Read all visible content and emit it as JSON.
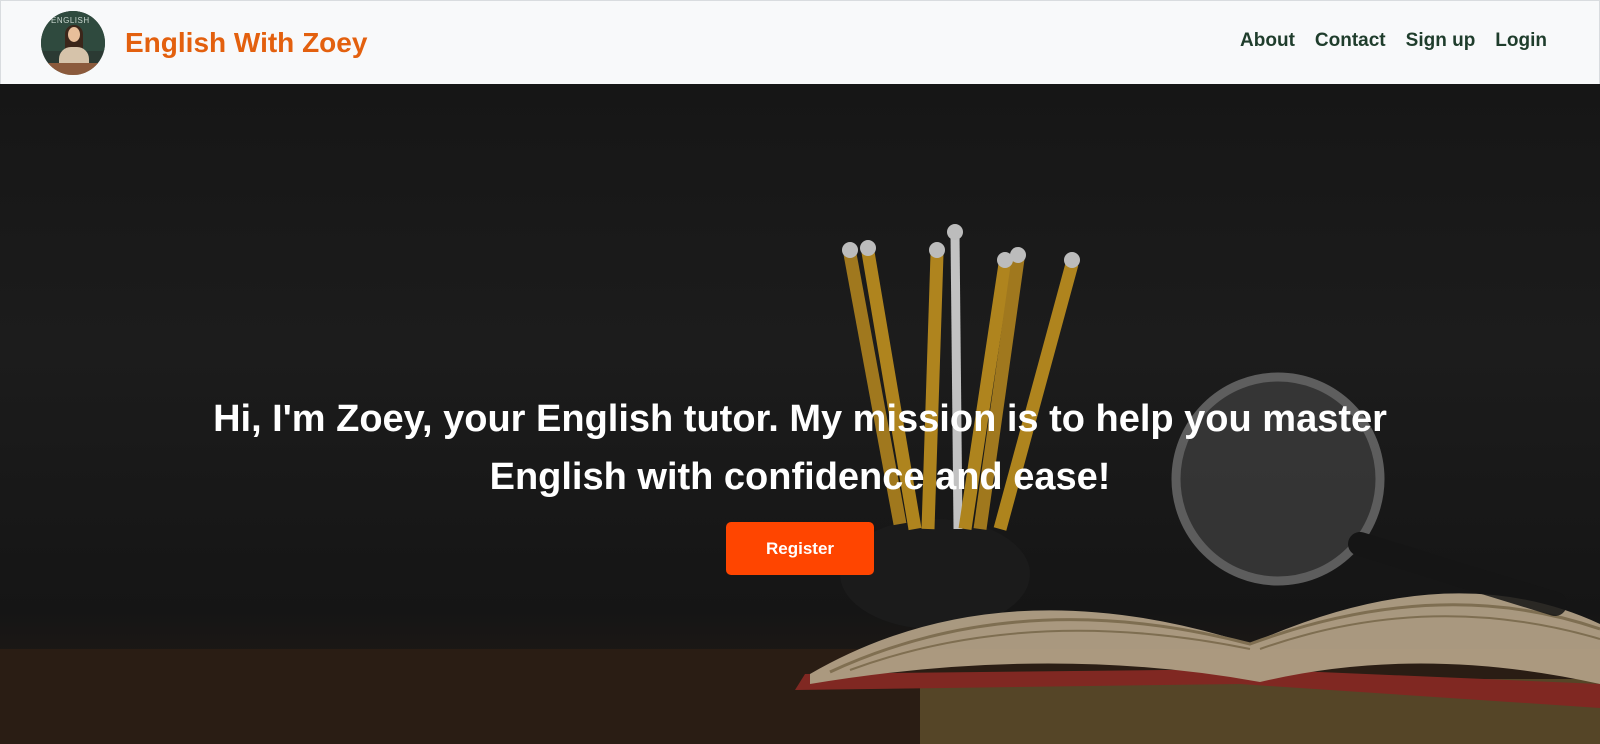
{
  "brand": {
    "name": "English With Zoey",
    "avatar_icon": "teacher-portrait",
    "avatar_board_text": "ENGLISH"
  },
  "nav": {
    "items": [
      {
        "label": "About"
      },
      {
        "label": "Contact"
      },
      {
        "label": "Sign up"
      },
      {
        "label": "Login"
      }
    ]
  },
  "hero": {
    "headline": "Hi, I'm Zoey, your English tutor. My mission is to help you master English with confidence and ease!",
    "register_label": "Register",
    "background_image": "pencils-books-magnifier"
  },
  "colors": {
    "brand": "#e3600e",
    "nav_text": "#1f3d2c",
    "button": "#ff4500",
    "navbar_bg": "#f8f9fa"
  }
}
